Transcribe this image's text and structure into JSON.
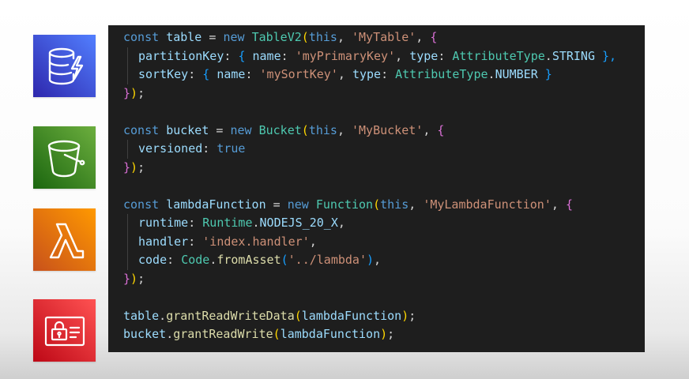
{
  "colors": {
    "background": "#ffffff",
    "editor_background": "#1e1e1e",
    "dynamodb": "#3b48cc",
    "s3": "#3f8624",
    "lambda": "#ed7100",
    "iam": "#dd344c"
  },
  "icons": [
    "dynamodb-icon",
    "s3-bucket-icon",
    "lambda-icon",
    "iam-icon"
  ],
  "code": {
    "l1": {
      "kw": "const",
      "name": "table",
      "eq": " = ",
      "new": "new",
      "cls": "TableV2",
      "open": "(",
      "this": "this",
      "comma": ", ",
      "str": "'MyTable'",
      "comma2": ", ",
      "brace": "{"
    },
    "l2": {
      "key": "partitionKey",
      "colon": ": ",
      "ob": "{ ",
      "nk": "name",
      "nc": ": ",
      "nv": "'myPrimaryKey'",
      "sep": ", ",
      "tk": "type",
      "tc": ": ",
      "cls": "AttributeType",
      "dot": ".",
      "enum": "STRING",
      "cb": " },"
    },
    "l3": {
      "key": "sortKey",
      "colon": ": ",
      "ob": "{ ",
      "nk": "name",
      "nc": ": ",
      "nv": "'mySortKey'",
      "sep": ", ",
      "tk": "type",
      "tc": ": ",
      "cls": "AttributeType",
      "dot": ".",
      "enum": "NUMBER",
      "cb": " }"
    },
    "l4": {
      "brace": "}",
      "paren": ")",
      "semi": ";"
    },
    "l6": {
      "kw": "const",
      "name": "bucket",
      "eq": " = ",
      "new": "new",
      "cls": "Bucket",
      "open": "(",
      "this": "this",
      "comma": ", ",
      "str": "'MyBucket'",
      "comma2": ", ",
      "brace": "{"
    },
    "l7": {
      "key": "versioned",
      "colon": ": ",
      "val": "true"
    },
    "l8": {
      "brace": "}",
      "paren": ")",
      "semi": ";"
    },
    "l10": {
      "kw": "const",
      "name": "lambdaFunction",
      "eq": " = ",
      "new": "new",
      "cls": "Function",
      "open": "(",
      "this": "this",
      "comma": ", ",
      "str": "'MyLambdaFunction'",
      "comma2": ", ",
      "brace": "{"
    },
    "l11": {
      "key": "runtime",
      "colon": ": ",
      "cls": "Runtime",
      "dot": ".",
      "enum": "NODEJS_20_X",
      "comma": ","
    },
    "l12": {
      "key": "handler",
      "colon": ": ",
      "str": "'index.handler'",
      "comma": ","
    },
    "l13": {
      "key": "code",
      "colon": ": ",
      "cls": "Code",
      "dot": ".",
      "fn": "fromAsset",
      "open": "(",
      "str": "'../lambda'",
      "close": ")",
      "comma": ","
    },
    "l14": {
      "brace": "}",
      "paren": ")",
      "semi": ";"
    },
    "l16": {
      "obj": "table",
      "dot": ".",
      "fn": "grantReadWriteData",
      "open": "(",
      "arg": "lambdaFunction",
      "close": ")",
      "semi": ";"
    },
    "l17": {
      "obj": "bucket",
      "dot": ".",
      "fn": "grantReadWrite",
      "open": "(",
      "arg": "lambdaFunction",
      "close": ")",
      "semi": ";"
    }
  }
}
